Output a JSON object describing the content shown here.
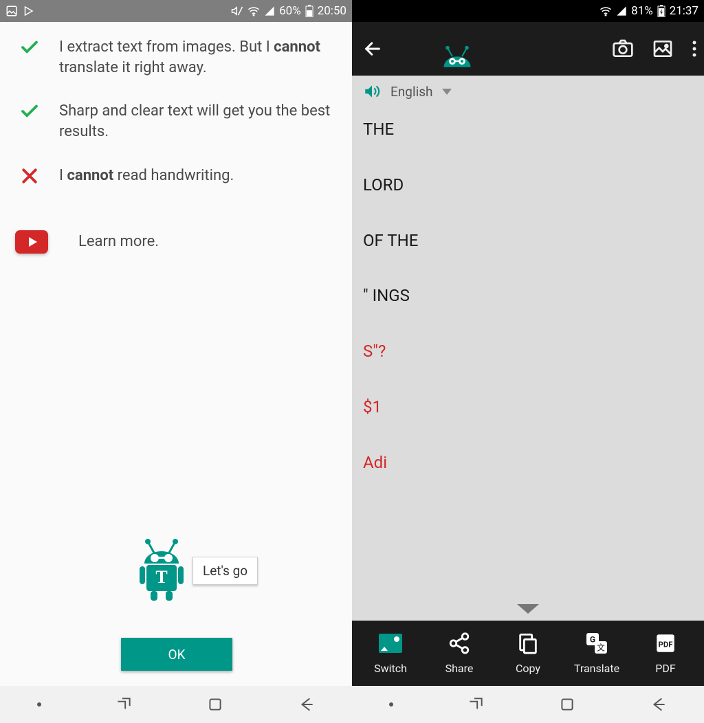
{
  "left": {
    "statusbar": {
      "battery": "60%",
      "time": "20:50"
    },
    "tips": [
      {
        "type": "check",
        "pre": "I extract text from images. But I ",
        "bold": "cannot",
        "post": " translate it right away."
      },
      {
        "type": "check",
        "pre": "Sharp and clear text will get you the best results.",
        "bold": "",
        "post": ""
      },
      {
        "type": "cross",
        "pre": "I ",
        "bold": "cannot",
        "post": " read handwriting."
      }
    ],
    "learn_more": "Learn more.",
    "letsgo": "Let's go",
    "ok": "OK"
  },
  "right": {
    "statusbar": {
      "battery": "81%",
      "time": "21:37"
    },
    "language": "English",
    "lines": [
      {
        "text": "THE",
        "cls": "black"
      },
      {
        "text": "LORD",
        "cls": "black"
      },
      {
        "text": "OF THE",
        "cls": "black"
      },
      {
        "text": "\" INGS",
        "cls": "black"
      },
      {
        "text": "S\"?",
        "cls": "red"
      },
      {
        "text": "$1",
        "cls": "red"
      },
      {
        "text": "Adi",
        "cls": "red"
      }
    ],
    "actions": {
      "switch": "Switch",
      "share": "Share",
      "copy": "Copy",
      "translate": "Translate",
      "pdf": "PDF"
    }
  }
}
